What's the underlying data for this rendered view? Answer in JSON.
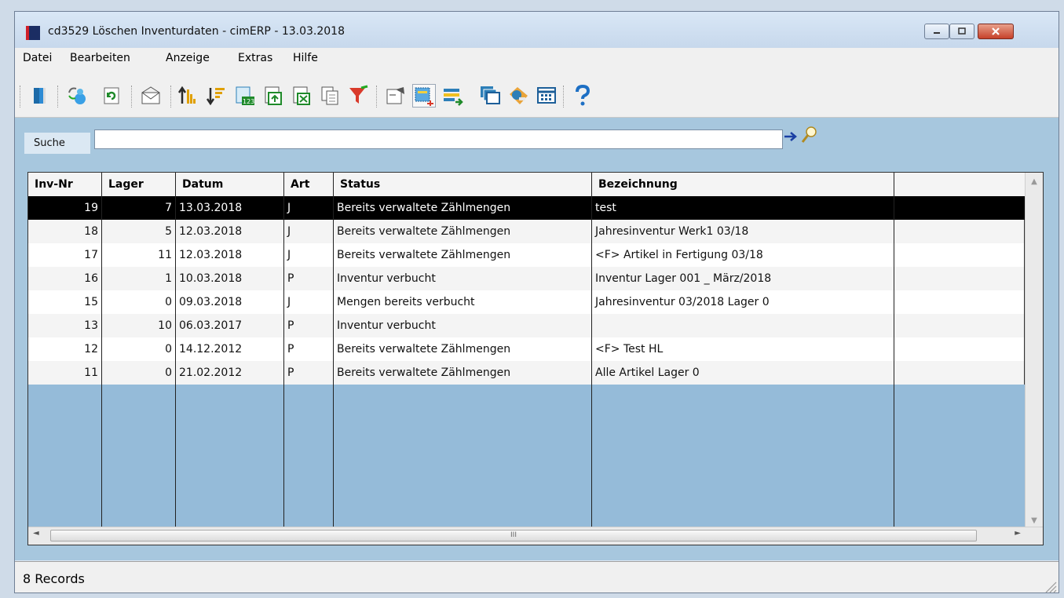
{
  "window": {
    "title": "cd3529 Löschen Inventurdaten - cimERP - 13.03.2018"
  },
  "menu": [
    "Datei",
    "Bearbeiten",
    "Anzeige",
    "Extras",
    "Hilfe"
  ],
  "toolbar_icons": [
    "exit-door-icon",
    "user-refresh-icon",
    "refresh-icon",
    "mail-icon",
    "sort-ascending-icon",
    "sort-descending-icon",
    "count-123-icon",
    "export-icon",
    "excel-export-icon",
    "copy-pages-icon",
    "filter-icon",
    "edit-card-icon",
    "new-record-icon",
    "list-transfer-icon",
    "windows-stack-icon",
    "label-tag-icon",
    "grid-view-icon",
    "help-question-icon"
  ],
  "search": {
    "label": "Suche",
    "value": ""
  },
  "table": {
    "columns": [
      "Inv-Nr",
      "Lager",
      "Datum",
      "Art",
      "Status",
      "Bezeichnung"
    ],
    "rows": [
      {
        "invnr": "19",
        "lager": "7",
        "datum": "13.03.2018",
        "art": "J",
        "status": "Bereits verwaltete Zählmengen",
        "bezeichnung": "test"
      },
      {
        "invnr": "18",
        "lager": "5",
        "datum": "12.03.2018",
        "art": "J",
        "status": "Bereits verwaltete Zählmengen",
        "bezeichnung": "Jahresinventur Werk1 03/18"
      },
      {
        "invnr": "17",
        "lager": "11",
        "datum": "12.03.2018",
        "art": "J",
        "status": "Bereits verwaltete Zählmengen",
        "bezeichnung": "<F> Artikel in Fertigung 03/18"
      },
      {
        "invnr": "16",
        "lager": "1",
        "datum": "10.03.2018",
        "art": "P",
        "status": "Inventur verbucht",
        "bezeichnung": "Inventur Lager 001 _ März/2018"
      },
      {
        "invnr": "15",
        "lager": "0",
        "datum": "09.03.2018",
        "art": "J",
        "status": "Mengen bereits verbucht",
        "bezeichnung": "Jahresinventur 03/2018 Lager 0"
      },
      {
        "invnr": "13",
        "lager": "10",
        "datum": "06.03.2017",
        "art": "P",
        "status": "Inventur verbucht",
        "bezeichnung": ""
      },
      {
        "invnr": "12",
        "lager": "0",
        "datum": "14.12.2012",
        "art": "P",
        "status": "Bereits verwaltete Zählmengen",
        "bezeichnung": "<F> Test HL"
      },
      {
        "invnr": "11",
        "lager": "0",
        "datum": "21.02.2012",
        "art": "P",
        "status": "Bereits verwaltete Zählmengen",
        "bezeichnung": "Alle Artikel Lager 0"
      }
    ]
  },
  "hscroll_thumb": "III",
  "status": {
    "text": "8 Records"
  },
  "colors": {
    "grid_bg": "#95bbd9",
    "search_bg": "#a7c7de",
    "selected_row": "#000000"
  }
}
